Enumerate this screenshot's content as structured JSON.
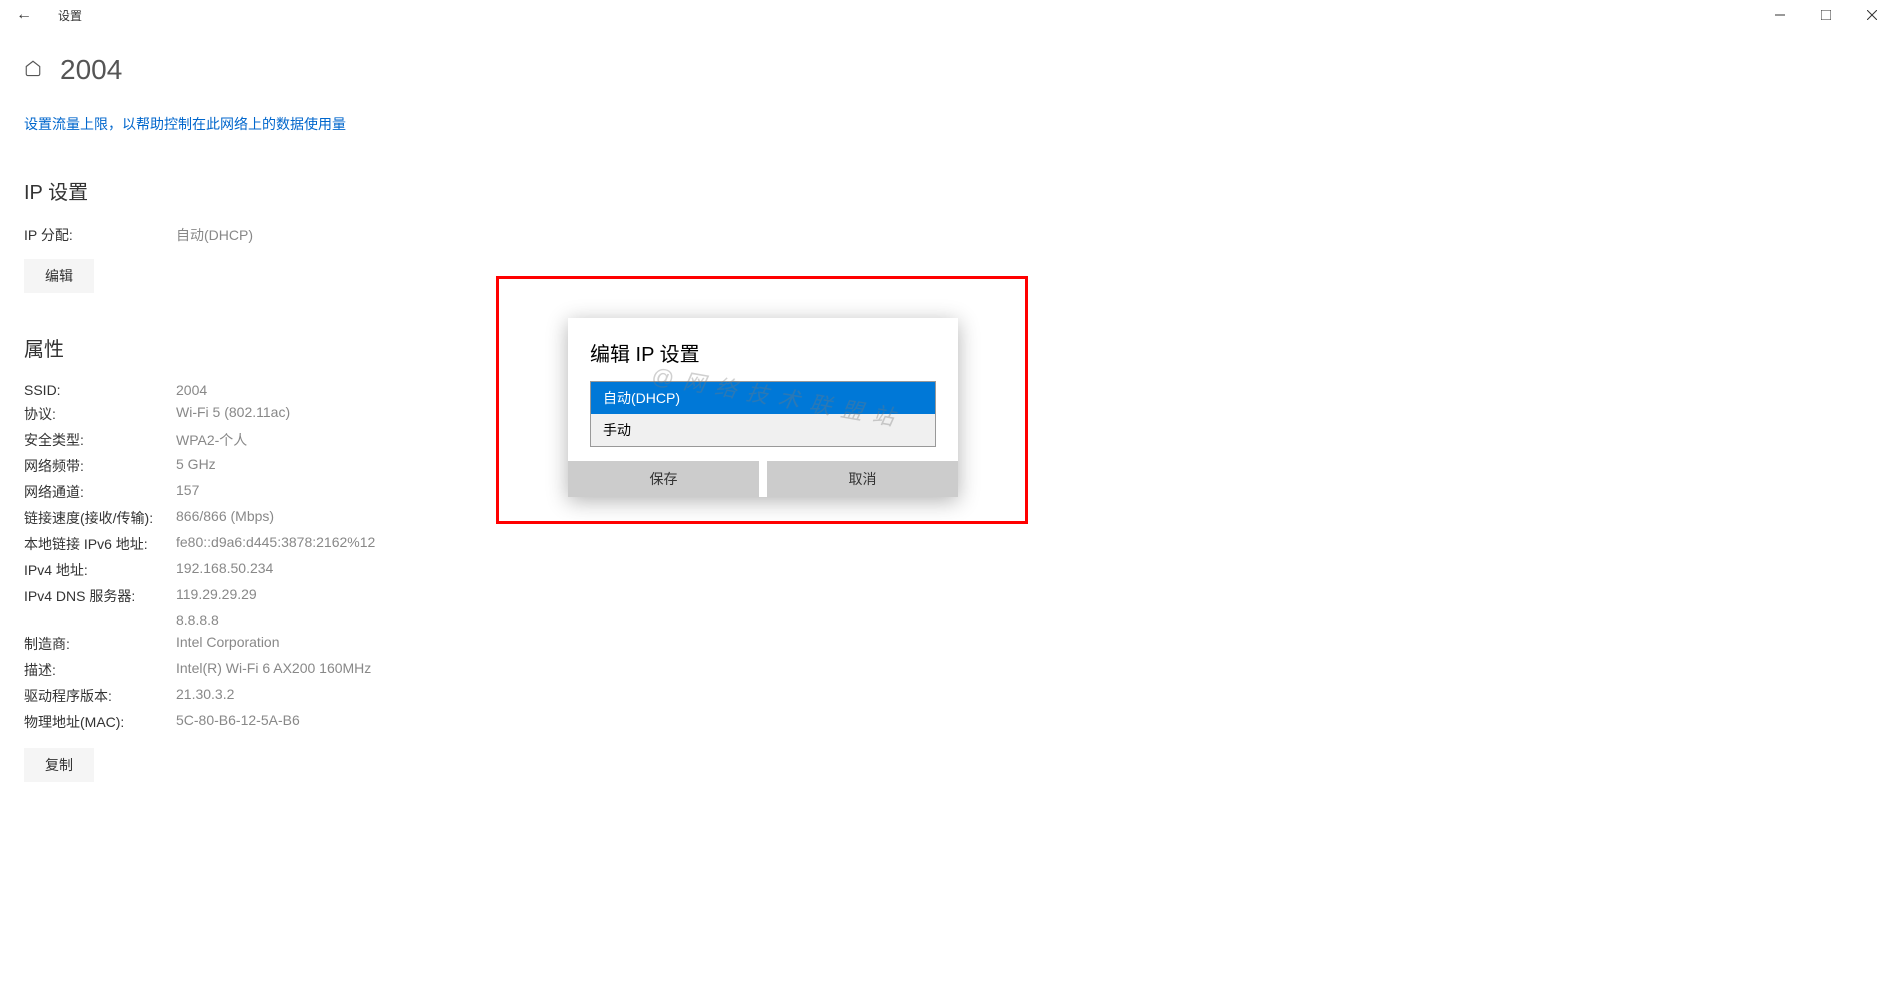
{
  "titlebar": {
    "title": "设置"
  },
  "header": {
    "page_title": "2004"
  },
  "data_limit_link": "设置流量上限，以帮助控制在此网络上的数据使用量",
  "ip_settings": {
    "heading": "IP 设置",
    "assignment_label": "IP 分配:",
    "assignment_value": "自动(DHCP)",
    "edit_button": "编辑"
  },
  "attributes": {
    "heading": "属性",
    "rows": [
      {
        "label": "SSID:",
        "value": "2004"
      },
      {
        "label": "协议:",
        "value": "Wi-Fi 5 (802.11ac)"
      },
      {
        "label": "安全类型:",
        "value": "WPA2-个人"
      },
      {
        "label": "网络频带:",
        "value": "5 GHz"
      },
      {
        "label": "网络通道:",
        "value": "157"
      },
      {
        "label": "链接速度(接收/传输):",
        "value": "866/866 (Mbps)"
      },
      {
        "label": "本地链接 IPv6 地址:",
        "value": "fe80::d9a6:d445:3878:2162%12"
      },
      {
        "label": "IPv4 地址:",
        "value": "192.168.50.234"
      },
      {
        "label": "IPv4 DNS 服务器:",
        "value": "119.29.29.29"
      },
      {
        "label": "",
        "value": "8.8.8.8"
      },
      {
        "label": "制造商:",
        "value": "Intel Corporation"
      },
      {
        "label": "描述:",
        "value": "Intel(R) Wi-Fi 6 AX200 160MHz"
      },
      {
        "label": "驱动程序版本:",
        "value": "21.30.3.2"
      },
      {
        "label": "物理地址(MAC):",
        "value": "5C-80-B6-12-5A-B6"
      }
    ],
    "copy_button": "复制"
  },
  "dialog": {
    "title": "编辑 IP 设置",
    "options": {
      "auto": "自动(DHCP)",
      "manual": "手动"
    },
    "save_button": "保存",
    "cancel_button": "取消"
  },
  "watermark": "@网络技术联盟站"
}
